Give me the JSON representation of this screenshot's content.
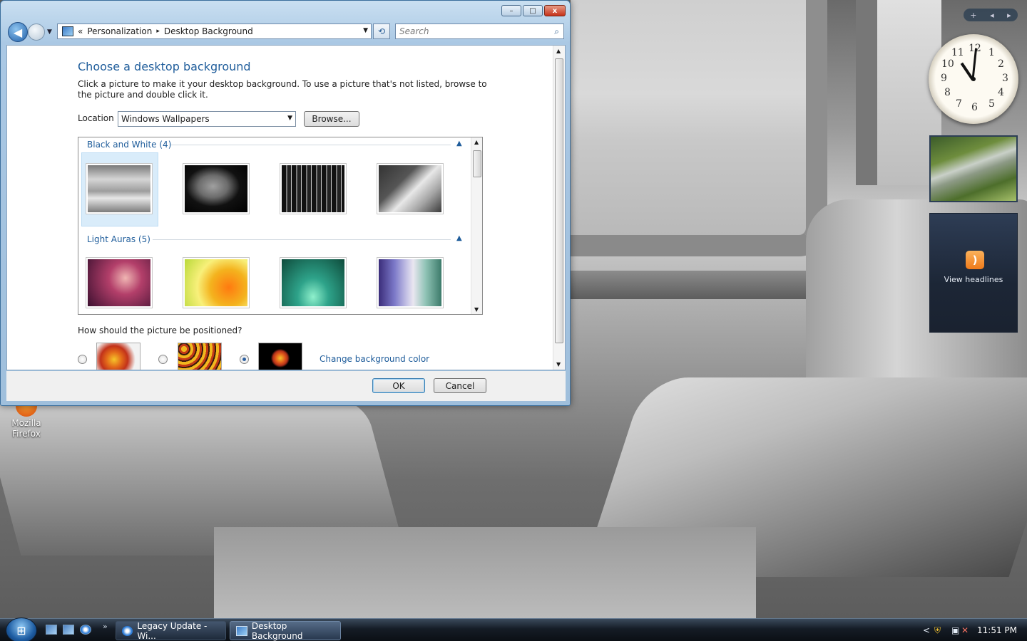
{
  "window": {
    "caption_min": "–",
    "caption_max": "□",
    "caption_close": "x",
    "breadcrumb_prefix": "«",
    "breadcrumb_1": "Personalization",
    "breadcrumb_sep": "▸",
    "breadcrumb_2": "Desktop Background",
    "search_placeholder": "Search",
    "heading": "Choose a desktop background",
    "description": "Click a picture to make it your desktop background. To use a picture that's not listed, browse to the picture and double click it.",
    "location_label": "Location",
    "location_value": "Windows Wallpapers",
    "browse_label": "Browse...",
    "groups": [
      {
        "title": "Black and White (4)"
      },
      {
        "title": "Light Auras (5)"
      }
    ],
    "position_question": "How should the picture be positioned?",
    "change_bg_color": "Change background color",
    "ok_label": "OK",
    "cancel_label": "Cancel"
  },
  "desktop": {
    "icon_label_1": "Mozilla",
    "icon_label_2": "Firefox"
  },
  "sidebar": {
    "add": "+",
    "prev": "◂",
    "next": "▸",
    "clock_numbers": [
      "12",
      "1",
      "2",
      "3",
      "4",
      "5",
      "6",
      "7",
      "8",
      "9",
      "10",
      "11"
    ],
    "feed_label": "View headlines"
  },
  "taskbar": {
    "more": "»",
    "task_1": "Legacy Update - Wi...",
    "task_2": "Desktop Background",
    "tray_show_hidden": "<",
    "time": "11:51 PM"
  }
}
